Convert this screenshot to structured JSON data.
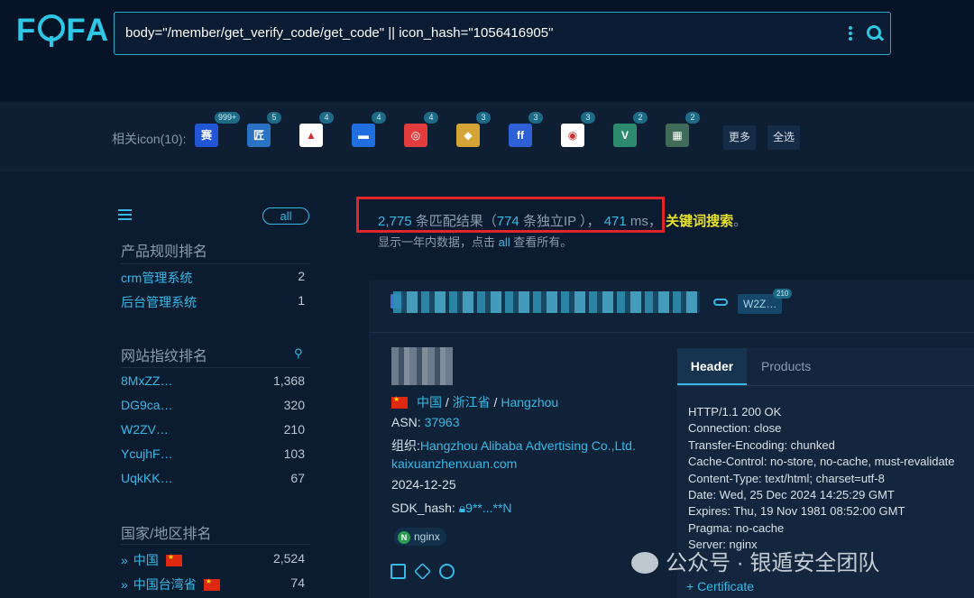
{
  "header": {
    "logo": "FOFA",
    "query": "body=\"/member/get_verify_code/get_code\" || icon_hash=\"1056416905\""
  },
  "icons": {
    "label": "相关icon(10):",
    "items": [
      {
        "badge": "999+",
        "color": "#2156d6",
        "glyph": "赛"
      },
      {
        "badge": "5",
        "color": "#2a72c4",
        "glyph": "匠"
      },
      {
        "badge": "4",
        "color": "#ffffff",
        "glyph": "▲"
      },
      {
        "badge": "4",
        "color": "#1f6fe0",
        "glyph": "▬"
      },
      {
        "badge": "4",
        "color": "#e23c3c",
        "glyph": "◎"
      },
      {
        "badge": "3",
        "color": "#d4a437",
        "glyph": "◆"
      },
      {
        "badge": "3",
        "color": "#2f61d6",
        "glyph": "ff"
      },
      {
        "badge": "3",
        "color": "#ffffff",
        "glyph": "◉"
      },
      {
        "badge": "2",
        "color": "#2d8a6d",
        "glyph": "V"
      },
      {
        "badge": "2",
        "color": "#3f6b58",
        "glyph": "▦"
      }
    ],
    "more": "更多",
    "select_all": "全选"
  },
  "sidebar": {
    "all": "all",
    "product_title": "产品规则排名",
    "products": [
      {
        "label": "crm管理系统",
        "count": "2"
      },
      {
        "label": "后台管理系统",
        "count": "1"
      }
    ],
    "fingerprint_title": "网站指纹排名",
    "fingerprints": [
      {
        "label": "8MxZZ…",
        "count": "1,368"
      },
      {
        "label": "DG9ca…",
        "count": "320"
      },
      {
        "label": "W2ZV…",
        "count": "210"
      },
      {
        "label": "YcujhF…",
        "count": "103"
      },
      {
        "label": "UqkKK…",
        "count": "67"
      }
    ],
    "country_title": "国家/地区排名",
    "countries": [
      {
        "label": "中国",
        "count": "2,524"
      },
      {
        "label": "中国台湾省",
        "count": "74"
      }
    ]
  },
  "summary": {
    "matches": "2,775",
    "matches_text": "条匹配结果（",
    "ips": "774",
    "ips_text": "条独立IP ），",
    "ms": "471",
    "ms_text": "ms，",
    "keyword": "关键词搜索",
    "period": "。",
    "hint_before": "显示一年内数据，点击",
    "hint_link": "all",
    "hint_after": "查看所有。"
  },
  "result": {
    "tag": "W2Z…",
    "tag_badge": "210",
    "country": "中国",
    "province": "浙江省",
    "city": "Hangzhou",
    "asn_label": "ASN:",
    "asn": "37963",
    "org_label": "组织:",
    "org": "Hangzhou Alibaba Advertising Co.,Ltd.",
    "domain": "kaixuanzhenxuan.com",
    "date": "2024-12-25",
    "sdk_label": "SDK_hash:",
    "sdk_value": "9**...**N",
    "server_tag": "nginx"
  },
  "panel": {
    "tab_header": "Header",
    "tab_products": "Products",
    "lines": [
      "HTTP/1.1 200 OK",
      "Connection: close",
      "Transfer-Encoding: chunked",
      "Cache-Control: no-store, no-cache, must-revalidate",
      "Content-Type: text/html; charset=utf-8",
      "Date: Wed, 25 Dec 2024 14:25:29 GMT",
      "Expires: Thu, 19 Nov 1981 08:52:00 GMT",
      "Pragma: no-cache",
      "Server: nginx"
    ],
    "certificate": "+ Certificate"
  },
  "watermark": "公众号 · 银遁安全团队"
}
